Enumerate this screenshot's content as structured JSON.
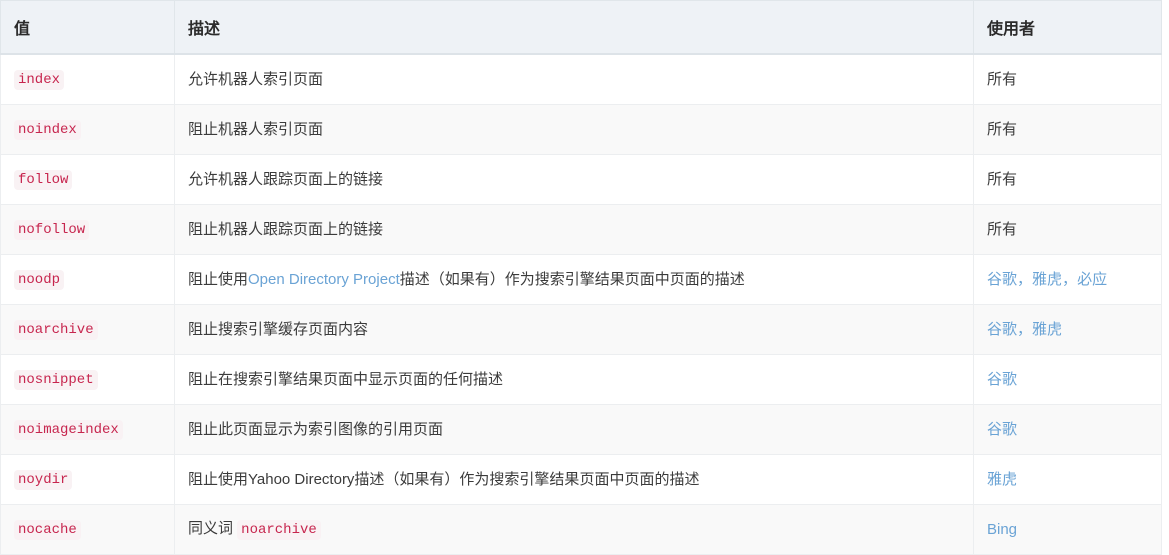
{
  "table": {
    "columns": [
      {
        "key": "value",
        "label": "值"
      },
      {
        "key": "description",
        "label": "描述"
      },
      {
        "key": "agents",
        "label": "使用者"
      }
    ],
    "rows": [
      {
        "value": "index",
        "description_parts": [
          {
            "type": "text",
            "text": "允许机器人索引页面"
          }
        ],
        "agents": [
          {
            "type": "text",
            "text": "所有"
          }
        ]
      },
      {
        "value": "noindex",
        "description_parts": [
          {
            "type": "text",
            "text": "阻止机器人索引页面"
          }
        ],
        "agents": [
          {
            "type": "text",
            "text": "所有"
          }
        ]
      },
      {
        "value": "follow",
        "description_parts": [
          {
            "type": "text",
            "text": "允许机器人跟踪页面上的链接"
          }
        ],
        "agents": [
          {
            "type": "text",
            "text": "所有"
          }
        ]
      },
      {
        "value": "nofollow",
        "description_parts": [
          {
            "type": "text",
            "text": "阻止机器人跟踪页面上的链接"
          }
        ],
        "agents": [
          {
            "type": "text",
            "text": "所有"
          }
        ]
      },
      {
        "value": "noodp",
        "description_parts": [
          {
            "type": "text",
            "text": "阻止使用"
          },
          {
            "type": "link",
            "text": "Open Directory Project"
          },
          {
            "type": "text",
            "text": "描述（如果有）作为搜索引擎结果页面中页面的描述"
          }
        ],
        "agents": [
          {
            "type": "link",
            "text": "谷歌"
          },
          {
            "type": "sep",
            "text": "，"
          },
          {
            "type": "link",
            "text": "雅虎"
          },
          {
            "type": "sep",
            "text": "，"
          },
          {
            "type": "link",
            "text": "必应"
          }
        ]
      },
      {
        "value": "noarchive",
        "description_parts": [
          {
            "type": "text",
            "text": "阻止搜索引擎缓存页面内容"
          }
        ],
        "agents": [
          {
            "type": "link",
            "text": "谷歌"
          },
          {
            "type": "sep",
            "text": "，"
          },
          {
            "type": "link",
            "text": "雅虎"
          }
        ]
      },
      {
        "value": "nosnippet",
        "description_parts": [
          {
            "type": "text",
            "text": "阻止在搜索引擎结果页面中显示页面的任何描述"
          }
        ],
        "agents": [
          {
            "type": "link",
            "text": "谷歌"
          }
        ]
      },
      {
        "value": "noimageindex",
        "description_parts": [
          {
            "type": "text",
            "text": "阻止此页面显示为索引图像的引用页面"
          }
        ],
        "agents": [
          {
            "type": "link",
            "text": "谷歌"
          }
        ]
      },
      {
        "value": "noydir",
        "description_parts": [
          {
            "type": "text",
            "text": "阻止使用Yahoo Directory描述（如果有）作为搜索引擎结果页面中页面的描述"
          }
        ],
        "agents": [
          {
            "type": "link",
            "text": "雅虎"
          }
        ]
      },
      {
        "value": "nocache",
        "description_parts": [
          {
            "type": "text",
            "text": "同义词 "
          },
          {
            "type": "code",
            "text": "noarchive"
          }
        ],
        "agents": [
          {
            "type": "link",
            "text": "Bing"
          }
        ]
      }
    ]
  },
  "colors": {
    "header_bg": "#eef2f6",
    "stripe_bg": "#f9f9f9",
    "row_bg": "#ffffff",
    "border": "#eceef0",
    "code_fg": "#c7254e",
    "code_bg": "#f9f2f4",
    "link": "#6aa3d5",
    "text": "#3b3b3b"
  }
}
